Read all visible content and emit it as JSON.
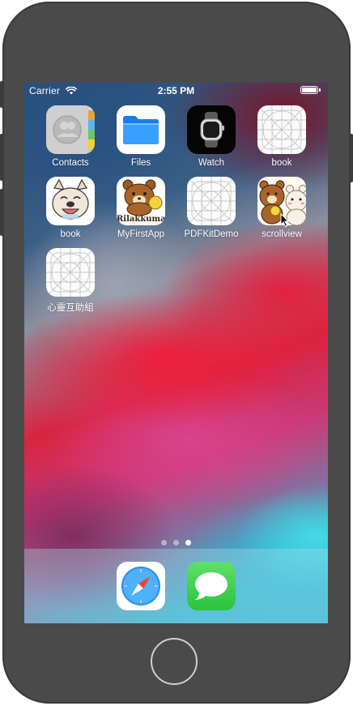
{
  "status_bar": {
    "carrier": "Carrier",
    "time": "2:55 PM"
  },
  "home_screen": {
    "apps": [
      {
        "label": "Contacts",
        "icon": "contacts-icon"
      },
      {
        "label": "Files",
        "icon": "files-icon"
      },
      {
        "label": "Watch",
        "icon": "watch-icon"
      },
      {
        "label": "book",
        "icon": "placeholder-app-icon"
      },
      {
        "label": "book",
        "icon": "bulldog-icon"
      },
      {
        "label": "MyFirstApp",
        "icon": "rilakkuma-icon"
      },
      {
        "label": "PDFKitDemo",
        "icon": "placeholder-app-icon"
      },
      {
        "label": "scrollview",
        "icon": "bears-icon"
      },
      {
        "label": "心靈互助組",
        "icon": "placeholder-app-icon"
      }
    ],
    "rilakkuma_text": "Rilakkuma",
    "page_indicator": {
      "pages": 3,
      "current": 3
    }
  },
  "dock": {
    "apps": [
      {
        "name": "Safari",
        "icon": "safari-icon"
      },
      {
        "name": "Messages",
        "icon": "messages-icon"
      }
    ]
  },
  "colors": {
    "device": "#4a4a4a",
    "files_blue": "#1e88f5",
    "messages_green": "#34c759"
  }
}
